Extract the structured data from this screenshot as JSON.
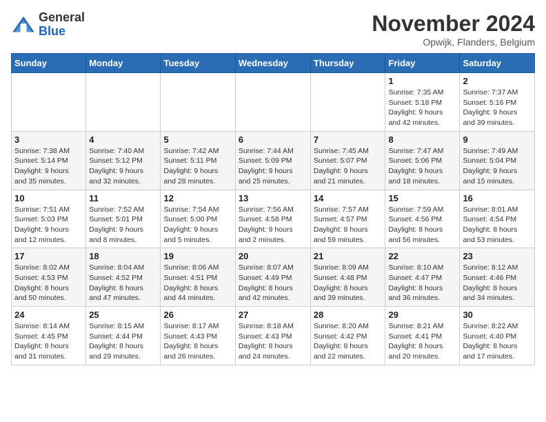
{
  "logo": {
    "general": "General",
    "blue": "Blue"
  },
  "title": "November 2024",
  "location": "Opwijk, Flanders, Belgium",
  "days_of_week": [
    "Sunday",
    "Monday",
    "Tuesday",
    "Wednesday",
    "Thursday",
    "Friday",
    "Saturday"
  ],
  "weeks": [
    [
      {
        "day": "",
        "info": ""
      },
      {
        "day": "",
        "info": ""
      },
      {
        "day": "",
        "info": ""
      },
      {
        "day": "",
        "info": ""
      },
      {
        "day": "",
        "info": ""
      },
      {
        "day": "1",
        "info": "Sunrise: 7:35 AM\nSunset: 5:18 PM\nDaylight: 9 hours\nand 42 minutes."
      },
      {
        "day": "2",
        "info": "Sunrise: 7:37 AM\nSunset: 5:16 PM\nDaylight: 9 hours\nand 39 minutes."
      }
    ],
    [
      {
        "day": "3",
        "info": "Sunrise: 7:38 AM\nSunset: 5:14 PM\nDaylight: 9 hours\nand 35 minutes."
      },
      {
        "day": "4",
        "info": "Sunrise: 7:40 AM\nSunset: 5:12 PM\nDaylight: 9 hours\nand 32 minutes."
      },
      {
        "day": "5",
        "info": "Sunrise: 7:42 AM\nSunset: 5:11 PM\nDaylight: 9 hours\nand 28 minutes."
      },
      {
        "day": "6",
        "info": "Sunrise: 7:44 AM\nSunset: 5:09 PM\nDaylight: 9 hours\nand 25 minutes."
      },
      {
        "day": "7",
        "info": "Sunrise: 7:45 AM\nSunset: 5:07 PM\nDaylight: 9 hours\nand 21 minutes."
      },
      {
        "day": "8",
        "info": "Sunrise: 7:47 AM\nSunset: 5:06 PM\nDaylight: 9 hours\nand 18 minutes."
      },
      {
        "day": "9",
        "info": "Sunrise: 7:49 AM\nSunset: 5:04 PM\nDaylight: 9 hours\nand 15 minutes."
      }
    ],
    [
      {
        "day": "10",
        "info": "Sunrise: 7:51 AM\nSunset: 5:03 PM\nDaylight: 9 hours\nand 12 minutes."
      },
      {
        "day": "11",
        "info": "Sunrise: 7:52 AM\nSunset: 5:01 PM\nDaylight: 9 hours\nand 8 minutes."
      },
      {
        "day": "12",
        "info": "Sunrise: 7:54 AM\nSunset: 5:00 PM\nDaylight: 9 hours\nand 5 minutes."
      },
      {
        "day": "13",
        "info": "Sunrise: 7:56 AM\nSunset: 4:58 PM\nDaylight: 9 hours\nand 2 minutes."
      },
      {
        "day": "14",
        "info": "Sunrise: 7:57 AM\nSunset: 4:57 PM\nDaylight: 8 hours\nand 59 minutes."
      },
      {
        "day": "15",
        "info": "Sunrise: 7:59 AM\nSunset: 4:56 PM\nDaylight: 8 hours\nand 56 minutes."
      },
      {
        "day": "16",
        "info": "Sunrise: 8:01 AM\nSunset: 4:54 PM\nDaylight: 8 hours\nand 53 minutes."
      }
    ],
    [
      {
        "day": "17",
        "info": "Sunrise: 8:02 AM\nSunset: 4:53 PM\nDaylight: 8 hours\nand 50 minutes."
      },
      {
        "day": "18",
        "info": "Sunrise: 8:04 AM\nSunset: 4:52 PM\nDaylight: 8 hours\nand 47 minutes."
      },
      {
        "day": "19",
        "info": "Sunrise: 8:06 AM\nSunset: 4:51 PM\nDaylight: 8 hours\nand 44 minutes."
      },
      {
        "day": "20",
        "info": "Sunrise: 8:07 AM\nSunset: 4:49 PM\nDaylight: 8 hours\nand 42 minutes."
      },
      {
        "day": "21",
        "info": "Sunrise: 8:09 AM\nSunset: 4:48 PM\nDaylight: 8 hours\nand 39 minutes."
      },
      {
        "day": "22",
        "info": "Sunrise: 8:10 AM\nSunset: 4:47 PM\nDaylight: 8 hours\nand 36 minutes."
      },
      {
        "day": "23",
        "info": "Sunrise: 8:12 AM\nSunset: 4:46 PM\nDaylight: 8 hours\nand 34 minutes."
      }
    ],
    [
      {
        "day": "24",
        "info": "Sunrise: 8:14 AM\nSunset: 4:45 PM\nDaylight: 8 hours\nand 31 minutes."
      },
      {
        "day": "25",
        "info": "Sunrise: 8:15 AM\nSunset: 4:44 PM\nDaylight: 8 hours\nand 29 minutes."
      },
      {
        "day": "26",
        "info": "Sunrise: 8:17 AM\nSunset: 4:43 PM\nDaylight: 8 hours\nand 26 minutes."
      },
      {
        "day": "27",
        "info": "Sunrise: 8:18 AM\nSunset: 4:43 PM\nDaylight: 8 hours\nand 24 minutes."
      },
      {
        "day": "28",
        "info": "Sunrise: 8:20 AM\nSunset: 4:42 PM\nDaylight: 8 hours\nand 22 minutes."
      },
      {
        "day": "29",
        "info": "Sunrise: 8:21 AM\nSunset: 4:41 PM\nDaylight: 8 hours\nand 20 minutes."
      },
      {
        "day": "30",
        "info": "Sunrise: 8:22 AM\nSunset: 4:40 PM\nDaylight: 8 hours\nand 17 minutes."
      }
    ]
  ]
}
